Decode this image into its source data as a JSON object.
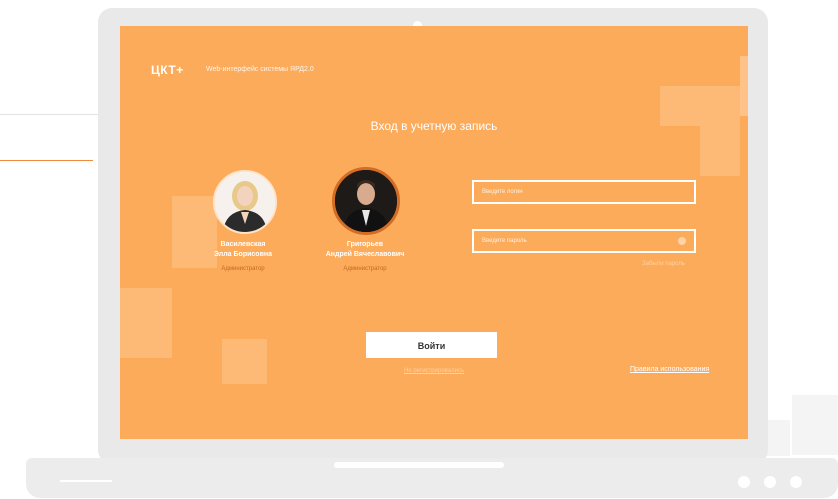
{
  "app": {
    "logo": "ЦКТ+",
    "subtitle": "Web-интерфейс системы ЯРД2.0"
  },
  "login": {
    "title": "Вход в учетную запись",
    "login_placeholder": "Введите логин",
    "password_placeholder": "Введите пароль",
    "forgot_link": "Забыли пароль",
    "submit_label": "Войти",
    "not_registered_link": "Не регистрировались",
    "terms_link": "Правила использования"
  },
  "users": [
    {
      "name_line1": "Василевская",
      "name_line2": "Элла Борисовна",
      "role": "Администратор"
    },
    {
      "name_line1": "Григорьев",
      "name_line2": "Андрей Вячеславович",
      "role": "Администратор"
    }
  ],
  "colors": {
    "screen_bg": "#fcab5b",
    "accent_line": "#f08a3c",
    "button_bg": "#ffffff"
  }
}
